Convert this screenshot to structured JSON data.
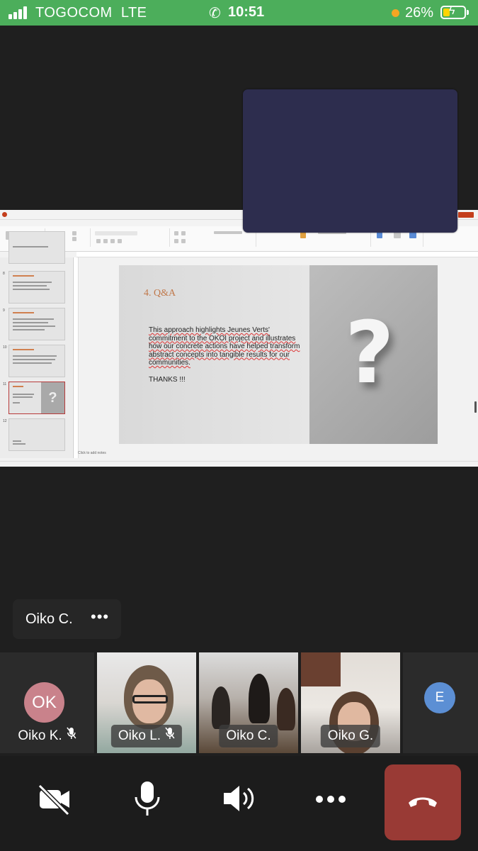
{
  "status_bar": {
    "carrier": "TOGOCOM",
    "network": "LTE",
    "time": "10:51",
    "battery": "26%",
    "colors": {
      "background": "#4cae5b",
      "battery_fill": "#ffd400",
      "dot": "#f5a623"
    }
  },
  "shared_screen": {
    "slide": {
      "title": "4. Q&A",
      "body": "This approach highlights Jeunes Verts' commitment to the OKOI project and illustrates how our concrete actions have helped transform abstract concepts into tangible results for our communities.",
      "closing": "THANKS !!!",
      "graphic": "?"
    },
    "thumbnails": [
      "8",
      "9",
      "10",
      "11",
      "12"
    ],
    "selected_thumbnail": "11",
    "notes_placeholder": "Click to add notes"
  },
  "active_speaker": {
    "name": "Oiko C.",
    "more": "•••"
  },
  "participants": [
    {
      "name": "Oiko K.",
      "initials": "OK",
      "muted": true,
      "avatar_color": "#c9828b"
    },
    {
      "name": "Oiko L.",
      "muted": true
    },
    {
      "name": "Oiko C.",
      "muted": false
    },
    {
      "name": "Oiko G.",
      "muted": false
    },
    {
      "initials": "E",
      "avatar_color": "#5c8fd4"
    }
  ],
  "controls": {
    "video": "camera-off-icon",
    "mic": "microphone-icon",
    "speaker": "speaker-icon",
    "more": "more-icon",
    "hangup": "hang-up-icon",
    "hangup_color": "#993a35"
  }
}
